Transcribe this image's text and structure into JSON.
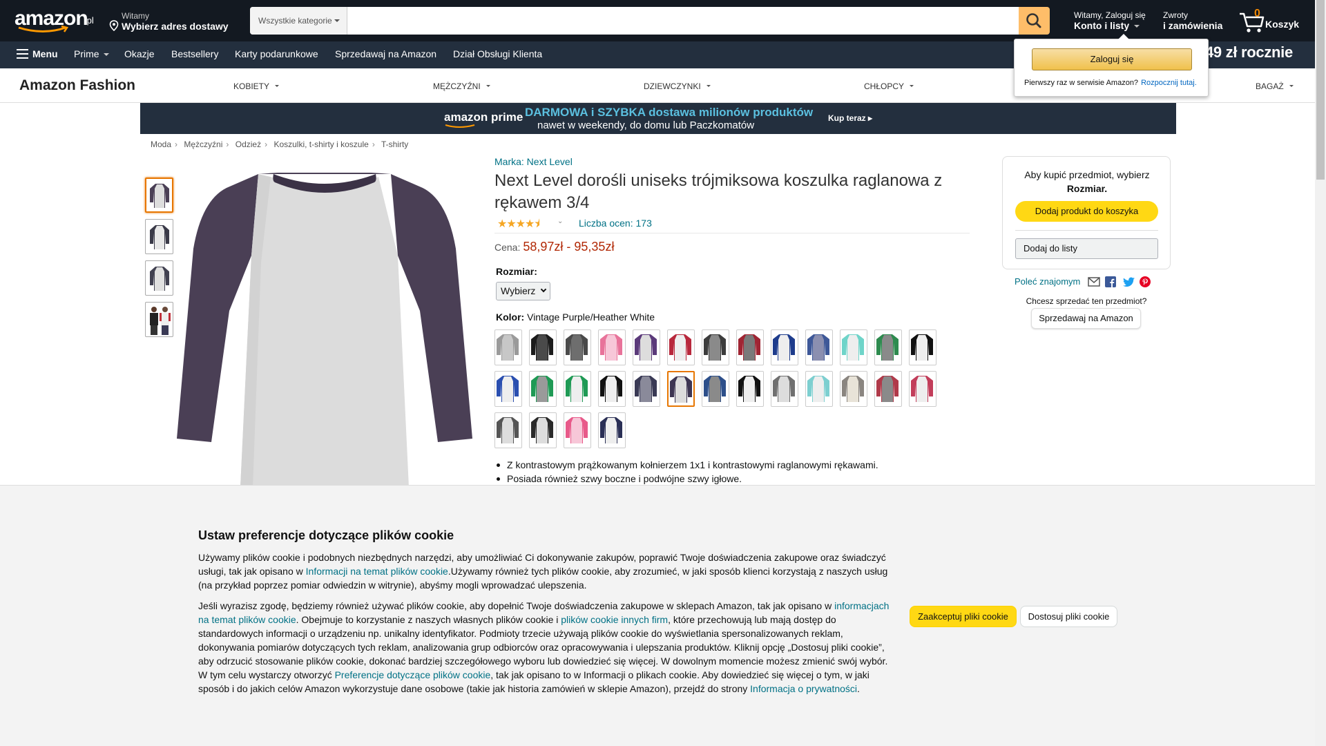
{
  "header": {
    "logo_text": "amazon",
    "logo_suffix": ".pl",
    "deliver_line1": "Witamy",
    "deliver_line2": "Wybierz adres dostawy",
    "search_category": "Wszystkie kategorie",
    "search_value": "",
    "account_line1": "Witamy, Zaloguj się",
    "account_line2": "Konto i listy",
    "returns_line1": "Zwroty",
    "returns_line2": "i zamówienia",
    "cart_count": "0",
    "cart_label": "Koszyk"
  },
  "nav": {
    "menu": "Menu",
    "items": [
      "Prime",
      "Okazje",
      "Bestsellery",
      "Karty podarunkowe",
      "Sprzedawaj na Amazon",
      "Dział Obsługi Klienta"
    ],
    "promo": "49 zł rocznie"
  },
  "signin_popup": {
    "button": "Zaloguj się",
    "text": "Pierwszy raz w serwisie Amazon?",
    "link": "Rozpocznij tutaj."
  },
  "fashion_nav": {
    "brand": "Amazon Fashion",
    "categories": [
      "KOBIETY",
      "MĘŻCZYŹNI",
      "DZIEWCZYNKI",
      "CHŁOPCY",
      "BAGAŻ"
    ]
  },
  "prime_banner": {
    "logo": "amazon prime",
    "line1": "DARMOWA i SZYBKA dostawa milionów produktów",
    "line2": "nawet w weekendy, do domu lub Paczkomatów",
    "cta": "Kup teraz ▸"
  },
  "breadcrumb": [
    "Moda",
    "Mężczyźni",
    "Odzież",
    "Koszulki, t-shirty i koszule",
    "T-shirty"
  ],
  "product": {
    "brand": "Marka: Next Level",
    "title": "Next Level dorośli uniseks trójmiksowa koszulka raglanowa z rękawem 3/4",
    "rating_stars": 4.5,
    "rating_count": "Liczba ocen: 173",
    "price_label": "Cena:",
    "price": "58,97zł - 95,35zł",
    "size_label": "Rozmiar:",
    "size_value": "Wybierz",
    "color_label": "Kolor:",
    "color_value": "Vintage Purple/Heather White",
    "bullets": [
      "Z kontrastowym prążkowanym kołnierzem 1x1 i kontrastowymi raglanowymi rękawami.",
      "Posiada również szwy boczne i podwójne szwy igłowe."
    ],
    "swatch_colors": [
      [
        "#9a9a9a",
        "#c7c7c7"
      ],
      [
        "#1c1c1c",
        "#4a4a4a"
      ],
      [
        "#4a4a4a",
        "#6e6e6e"
      ],
      [
        "#e8739a",
        "#f7c7d8"
      ],
      [
        "#5b3a7a",
        "#ddd"
      ],
      [
        "#b8283c",
        "#eee"
      ],
      [
        "#3c3c3c",
        "#8a8a8a"
      ],
      [
        "#a02533",
        "#7a7a7a"
      ],
      [
        "#1e3c8c",
        "#eee"
      ],
      [
        "#3e5898",
        "#8b8fb0"
      ],
      [
        "#6fd4c9",
        "#eee"
      ],
      [
        "#2e8b4f",
        "#8a8a8a"
      ],
      [
        "#111",
        "#eee"
      ],
      [
        "#2a4fb0",
        "#eee"
      ],
      [
        "#1f9a55",
        "#9a9a9a"
      ],
      [
        "#1f9a55",
        "#eee"
      ],
      [
        "#111",
        "#eee"
      ],
      [
        "#3a3a55",
        "#8a8a9a"
      ],
      [
        "#3d3552",
        "#dcdcdc"
      ],
      [
        "#2d4f8a",
        "#8a8a8a"
      ],
      [
        "#111",
        "#eee"
      ],
      [
        "#707070",
        "#ddd"
      ],
      [
        "#7dcfd0",
        "#eee"
      ],
      [
        "#8a8580",
        "#e8e3d8"
      ],
      [
        "#b03a4a",
        "#8a8a8a"
      ],
      [
        "#c23d5a",
        "#eee"
      ],
      [
        "#555",
        "#ddd"
      ],
      [
        "#2a2a2a",
        "#ddd"
      ],
      [
        "#e85a8a",
        "#f7c7d8"
      ],
      [
        "#2a2f55",
        "#eee"
      ]
    ],
    "selected_swatch": 18
  },
  "buybox": {
    "message_line1": "Aby kupić przedmiot, wybierz",
    "message_line2": "Rozmiar.",
    "add_to_cart": "Dodaj produkt do koszyka",
    "add_to_list": "Dodaj do listy",
    "share": "Poleć znajomym",
    "sell_question": "Chcesz sprzedać ten przedmiot?",
    "sell_button": "Sprzedawaj na Amazon"
  },
  "cookie": {
    "title": "Ustaw preferencje dotyczące plików cookie",
    "p1_a": "Używamy plików cookie i podobnych niezbędnych narzędzi, aby umożliwiać Ci dokonywanie zakupów, poprawić Twoje doświadczenia zakupowe oraz świadczyć usługi, tak jak opisano w ",
    "p1_link": "Informacji na temat plików cookie",
    "p1_b": ".Używamy również tych plików cookie, aby zrozumieć, w jaki sposób klienci korzystają z naszych usług (na przykład poprzez pomiar odwiedzin w witrynie), abyśmy mogli wprowadzać ulepszenia.",
    "p2_a": "Jeśli wyrazisz zgodę, będziemy również używać plików cookie, aby dopełnić Twoje doświadczenia zakupowe w sklepach Amazon, tak jak opisano w ",
    "p2_link1": "informacjach na temat plików cookie",
    "p2_b": ". Obejmuje to korzystanie z naszych własnych plików cookie i ",
    "p2_link2": "plików cookie innych firm",
    "p2_c": ", które przechowują lub mają dostęp do standardowych informacji o urządzeniu np. unikalny identyfikator. Podmioty trzecie używają plików cookie do wyświetlania spersonalizowanych reklam, dokonywania pomiarów dotyczących tych reklam, analizowania grup odbiorców oraz opracowywania i ulepszania produktów. Kliknij opcję „Dostosuj pliki cookie”, aby odrzucić stosowanie plików cookie, dokonać bardziej szczegółowego wyboru lub dowiedzieć się więcej. W dowolnym momencie możesz zmienić swój wybór. W tym celu wystarczy otworzyć ",
    "p2_link3": "Preferencje dotyczące plików cookie",
    "p2_d": ", tak jak opisano to w Informacji o plikach cookie. Aby dowiedzieć się więcej o tym, w jaki sposób i do jakich celów Amazon wykorzystuje dane osobowe (takie jak historia zamówień w sklepie Amazon), przejdź do strony ",
    "p2_link4": "Informacja o prywatności",
    "p2_e": ".",
    "accept": "Zaakceptuj pliki cookie",
    "customize": "Dostosuj pliki cookie"
  }
}
